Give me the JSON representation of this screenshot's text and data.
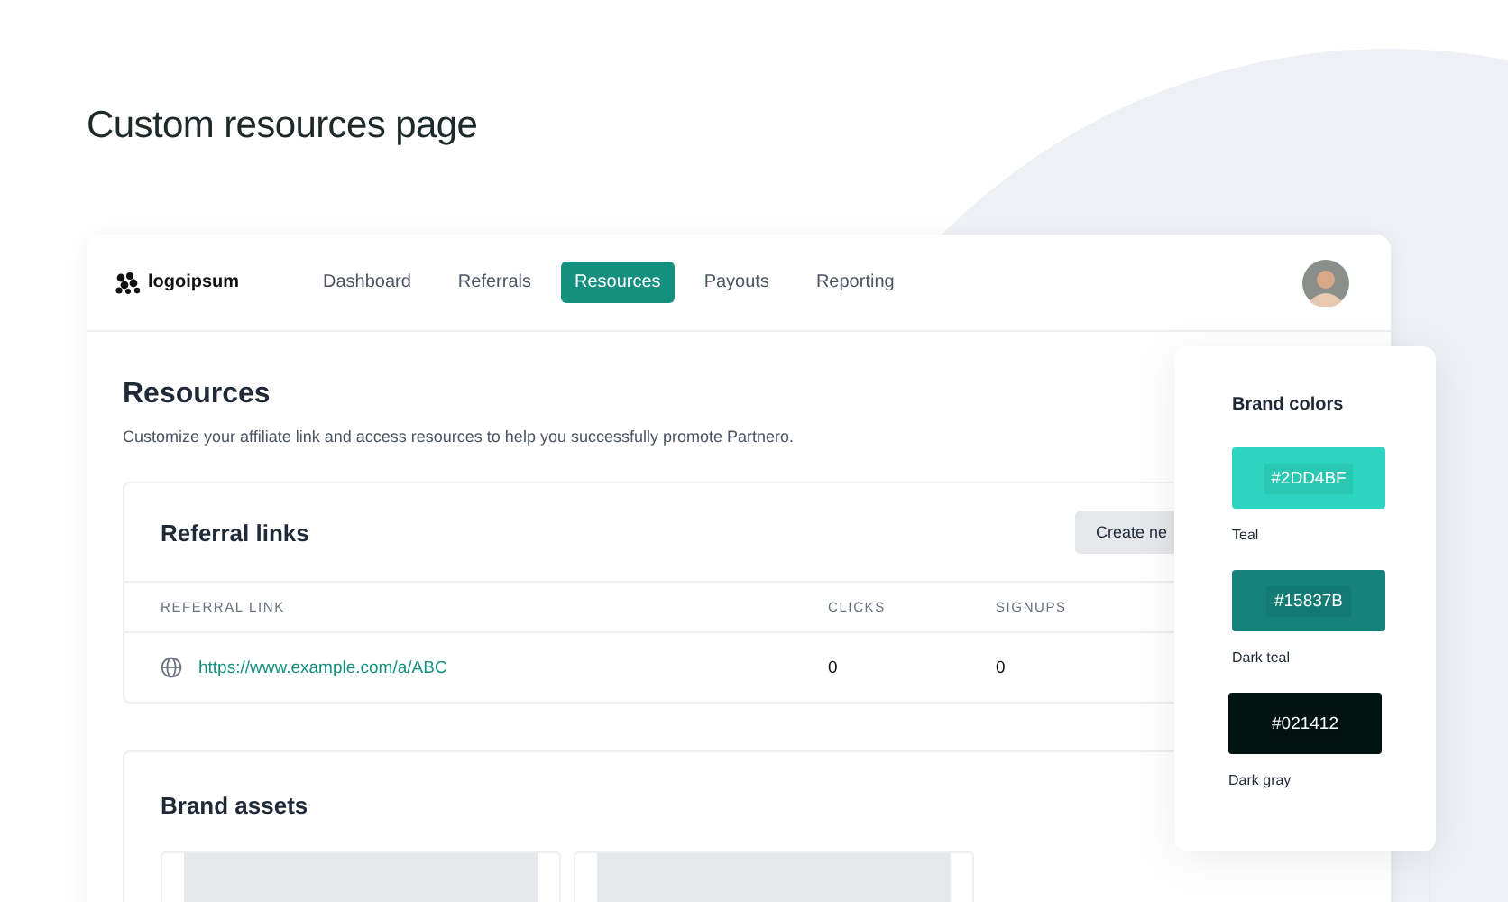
{
  "page_title": "Custom resources page",
  "app": {
    "logo": "logoipsum",
    "nav": [
      {
        "label": "Dashboard",
        "selected": false
      },
      {
        "label": "Referrals",
        "selected": false
      },
      {
        "label": "Resources",
        "selected": true
      },
      {
        "label": "Payouts",
        "selected": false
      },
      {
        "label": "Reporting",
        "selected": false
      }
    ],
    "heading": "Resources",
    "description": "Customize your affiliate link and access resources to help you successfully promote Partnero.",
    "referral_links": {
      "title": "Referral links",
      "button": "Create ne",
      "columns": [
        "REFERRAL LINK",
        "CLICKS",
        "SIGNUPS"
      ],
      "rows": [
        {
          "link": "https://www.example.com/a/ABC",
          "clicks": "0",
          "signups": "0"
        }
      ]
    },
    "brand_assets": {
      "title": "Brand assets"
    }
  },
  "brand_colors": {
    "title": "Brand colors",
    "colors": [
      {
        "hex": "#2DD4BF",
        "name": "Teal",
        "color": "#2dd4bf"
      },
      {
        "hex": "#15837B",
        "name": "Dark teal",
        "color": "#15837b"
      },
      {
        "hex": "#021412",
        "name": "Dark gray",
        "color": "#021412"
      }
    ]
  }
}
